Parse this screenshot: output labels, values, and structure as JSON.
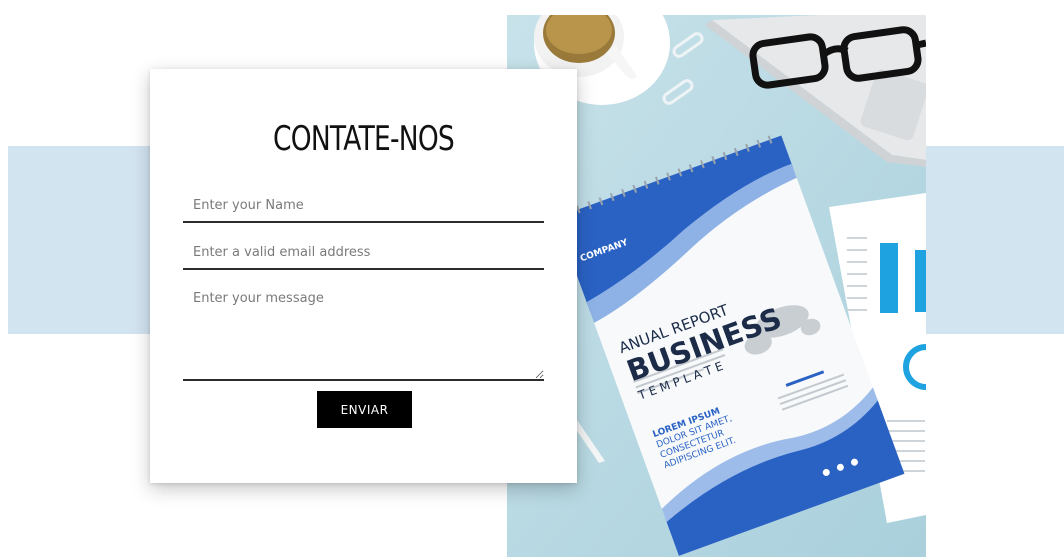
{
  "contact": {
    "title": "CONTATE-NOS",
    "name_placeholder": "Enter your Name",
    "email_placeholder": "Enter a valid email address",
    "message_placeholder": "Enter your message",
    "submit_label": "ENVIAR"
  },
  "photo": {
    "company_label": "COMPANY",
    "report_line1": "ANUAL REPORT",
    "report_line2": "BUSINESS",
    "report_line3": "T E M P L A T E",
    "lorem_line1": "LOREM IPSUM",
    "lorem_line2": "DOLOR SIT AMET,",
    "lorem_line3": "CONSECTETUR",
    "lorem_line4": "ADIPISCING ELIT."
  },
  "colors": {
    "band": "#d3e4f1",
    "photo_background": "#b9d9e2",
    "button": "#000000",
    "report_blue": "#2a62c4"
  }
}
